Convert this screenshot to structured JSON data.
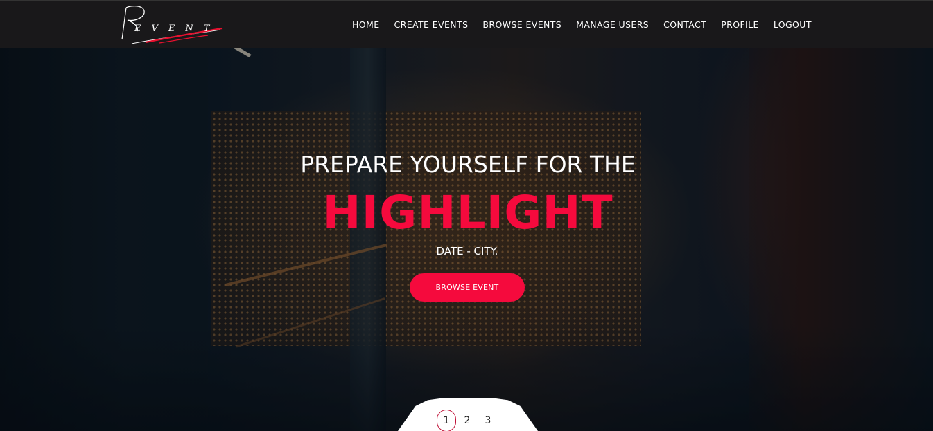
{
  "header": {
    "logo_text": "EVENT",
    "nav": [
      {
        "label": "HOME"
      },
      {
        "label": "CREATE EVENTS"
      },
      {
        "label": "BROWSE EVENTS"
      },
      {
        "label": "MANAGE USERS"
      },
      {
        "label": "CONTACT"
      },
      {
        "label": "PROFILE"
      },
      {
        "label": "LOGOUT"
      }
    ]
  },
  "hero": {
    "pre_title": "PREPARE YOURSELF FOR THE",
    "highlight": "HIGHLIGHT",
    "subtitle": "DATE - CITY.",
    "cta_label": "BROWSE EVENT"
  },
  "pager": {
    "pages": [
      "1",
      "2",
      "3"
    ],
    "active": "1"
  },
  "colors": {
    "accent": "#f50a3d",
    "header_bg": "#19181a",
    "text": "#ffffff"
  }
}
